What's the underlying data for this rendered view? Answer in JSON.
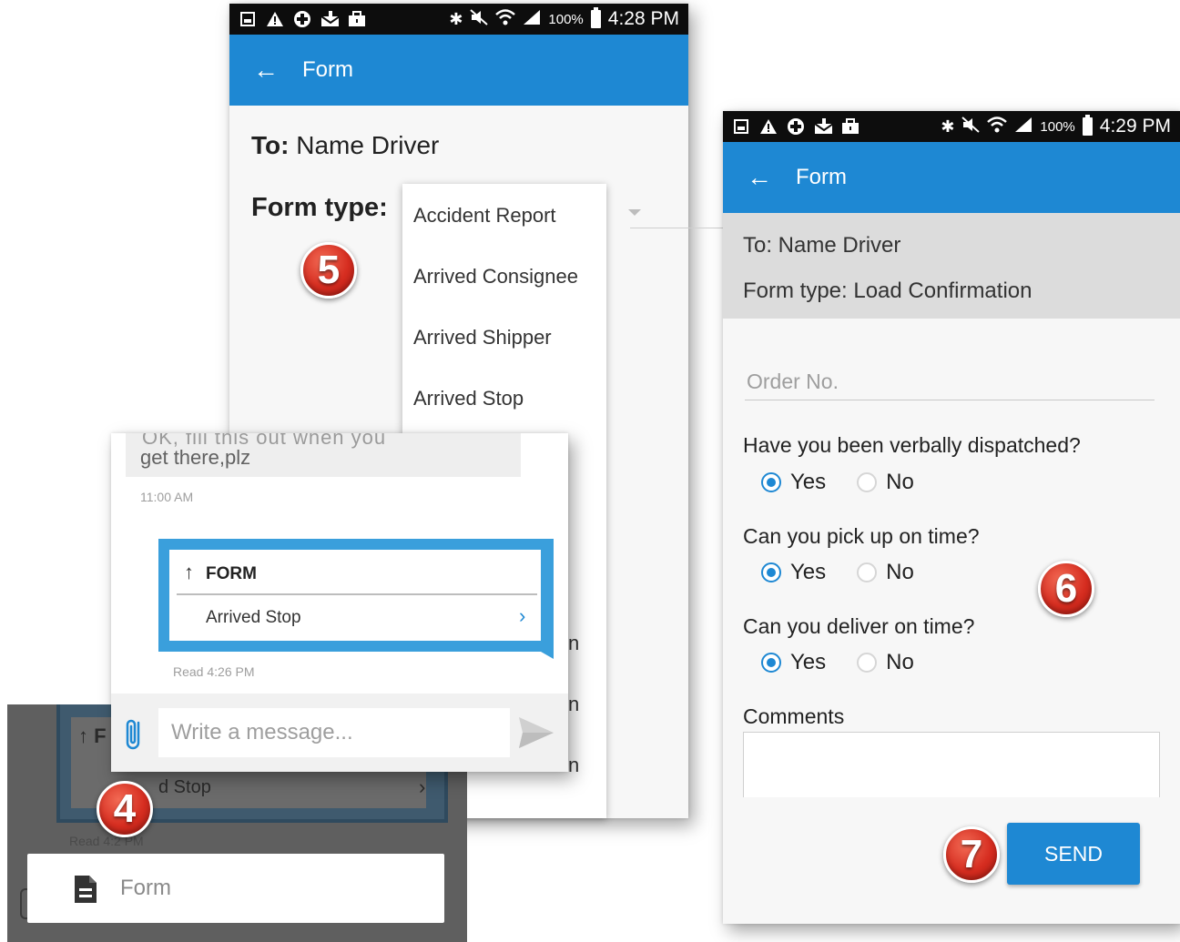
{
  "panel_form_select": {
    "status_bar": {
      "battery_pct": "100%",
      "time": "4:28 PM"
    },
    "app_bar": {
      "title": "Form"
    },
    "to_label": "To:",
    "to_value": "Name Driver",
    "form_type_label": "Form type:",
    "dropdown_options": [
      "Accident Report",
      "Arrived Consignee",
      "Arrived Shipper",
      "Arrived Stop"
    ],
    "dropdown_fragments": [
      "n",
      "n",
      "n"
    ]
  },
  "panel_chat": {
    "previous_message_cut": "OK, fill this out when you",
    "previous_message_text": "get there,plz",
    "previous_message_time": "11:00 AM",
    "form_message": {
      "title": "FORM",
      "item": "Arrived Stop"
    },
    "read_status": "Read 4:26 PM",
    "message_placeholder": "Write a message..."
  },
  "panel_attach": {
    "bubble_title_fragment": "F",
    "bubble_item_fragment": "d Stop",
    "read_fragment": "Read 4:2  PM",
    "menu_item": "Form"
  },
  "panel_form_fill": {
    "status_bar": {
      "battery_pct": "100%",
      "time": "4:29 PM"
    },
    "app_bar": {
      "title": "Form"
    },
    "to_text": "To:  Name Driver",
    "form_type_text": "Form type:  Load Confirmation",
    "order_placeholder": "Order No.",
    "questions": [
      {
        "text": "Have you been verbally dispatched?",
        "yes": "Yes",
        "no": "No",
        "selected": "Yes"
      },
      {
        "text": "Can you pick up on time?",
        "yes": "Yes",
        "no": "No",
        "selected": "Yes"
      },
      {
        "text": "Can you deliver on time?",
        "yes": "Yes",
        "no": "No",
        "selected": "Yes"
      }
    ],
    "comments_label": "Comments",
    "send_label": "SEND"
  },
  "steps": {
    "four": "4",
    "five": "5",
    "six": "6",
    "seven": "7"
  },
  "colors": {
    "accent": "#1e88d3",
    "badge": "#d62d20",
    "status_bar": "#0d0d0d"
  }
}
